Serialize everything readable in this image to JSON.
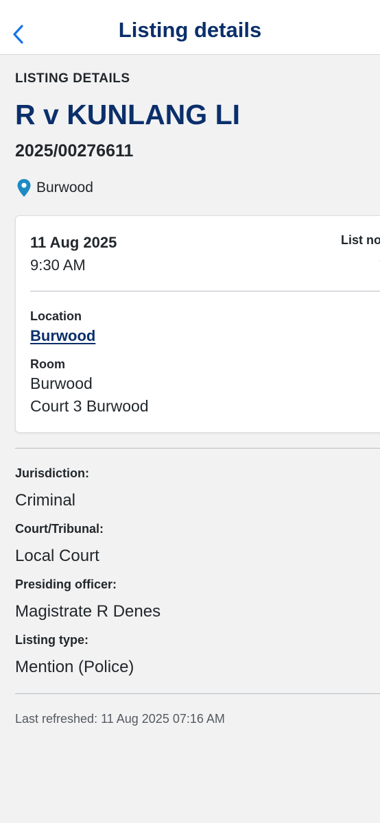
{
  "header": {
    "title": "Listing details"
  },
  "listing": {
    "section_label": "LISTING DETAILS",
    "case_title": "R v KUNLANG LI",
    "case_number": "2025/00276611",
    "location": "Burwood"
  },
  "card": {
    "date": "11 Aug 2025",
    "time": "9:30 AM",
    "list_no_label": "List no.",
    "list_no_value": "-",
    "location_label": "Location",
    "location_value": "Burwood",
    "room_label": "Room",
    "room_lines": [
      "Burwood",
      "Court 3 Burwood"
    ]
  },
  "details": [
    {
      "label": "Jurisdiction:",
      "value": "Criminal"
    },
    {
      "label": "Court/Tribunal:",
      "value": "Local Court"
    },
    {
      "label": "Presiding officer:",
      "value": "Magistrate R Denes"
    },
    {
      "label": "Listing type:",
      "value": "Mention (Police)"
    }
  ],
  "footer": {
    "last_refreshed": "Last refreshed: 11 Aug 2025 07:16 AM"
  },
  "colors": {
    "navy": "#0b2f6b",
    "back_arrow": "#1a73e8",
    "pin": "#1d8ac4",
    "background": "#f2f2f2"
  },
  "icons": {
    "back": "chevron-left-icon",
    "location": "map-pin-icon"
  }
}
